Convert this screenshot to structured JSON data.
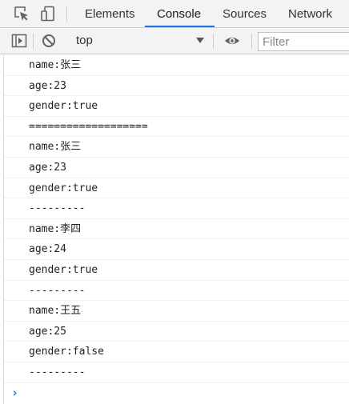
{
  "tabbar": {
    "icons": [
      "inspect-element-icon",
      "device-toolbar-icon"
    ],
    "tabs": [
      {
        "label": "Elements",
        "active": false
      },
      {
        "label": "Console",
        "active": true
      },
      {
        "label": "Sources",
        "active": false
      },
      {
        "label": "Network",
        "active": false
      }
    ]
  },
  "toolbar": {
    "context": "top",
    "filter_placeholder": "Filter",
    "filter_value": ""
  },
  "colors": {
    "accent": "#1a73e8",
    "toolbar_bg": "#f3f3f3",
    "border": "#cbcdd1"
  },
  "console": {
    "messages": [
      "name:张三",
      "age:23",
      "gender:true",
      "===================",
      "name:张三",
      "age:23",
      "gender:true",
      "---------",
      "name:李四",
      "age:24",
      "gender:true",
      "---------",
      "name:王五",
      "age:25",
      "gender:false",
      "---------"
    ],
    "prompt": "›"
  }
}
